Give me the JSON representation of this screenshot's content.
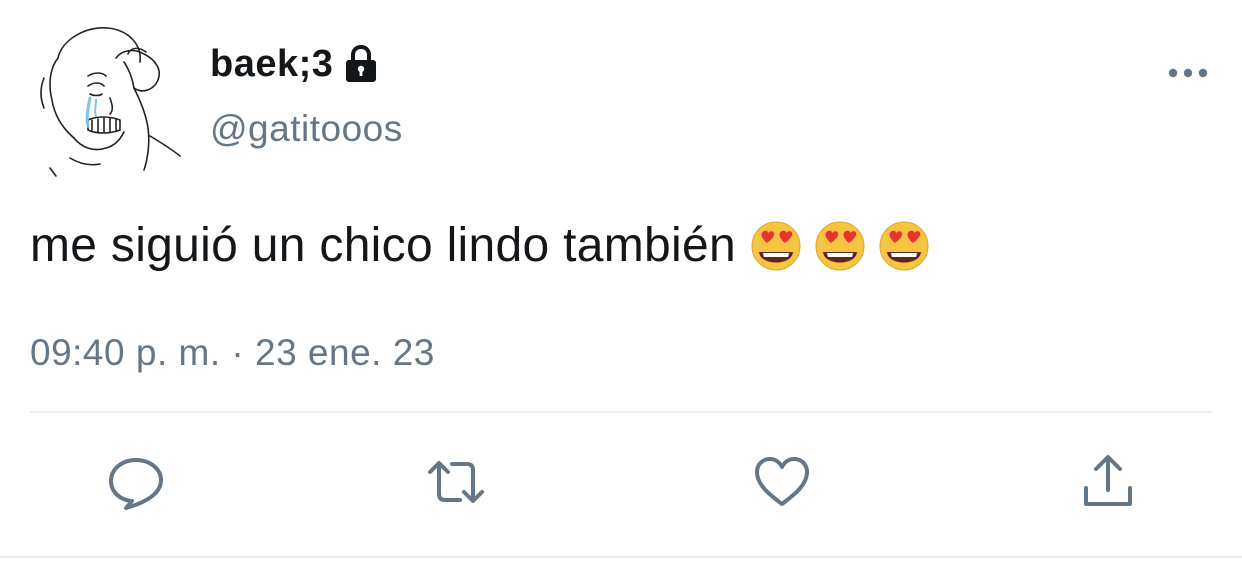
{
  "author": {
    "display_name": "baek;3",
    "handle": "@gatitooos",
    "avatar_icon": "crying-wojak-avatar",
    "protected_icon": "lock-icon"
  },
  "menu_icon": "more-dots-icon",
  "tweet": {
    "text": "me siguió un chico lindo también",
    "emojis": [
      "heart-eyes-emoji",
      "heart-eyes-emoji",
      "heart-eyes-emoji"
    ],
    "timestamp": "09:40 p. m. · 23 ene. 23"
  },
  "actions": [
    {
      "name": "reply",
      "icon": "reply-icon"
    },
    {
      "name": "retweet",
      "icon": "retweet-icon"
    },
    {
      "name": "like",
      "icon": "heart-icon"
    },
    {
      "name": "share",
      "icon": "share-icon"
    }
  ],
  "colors": {
    "text": "#14171a",
    "secondary": "#657786",
    "divider": "#e6ecf0"
  }
}
